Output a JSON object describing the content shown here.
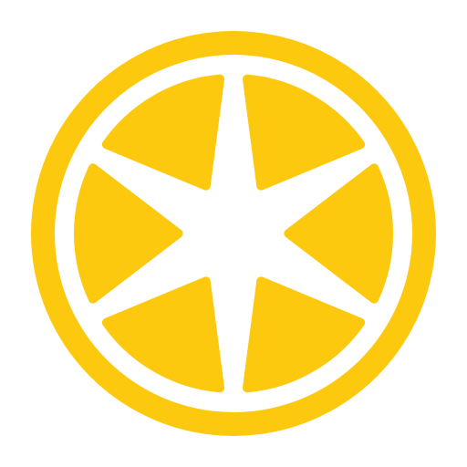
{
  "icon": {
    "name": "lemon-slice-icon",
    "colors": {
      "primary": "#FDC90F",
      "background": "#FFFFFF"
    }
  }
}
